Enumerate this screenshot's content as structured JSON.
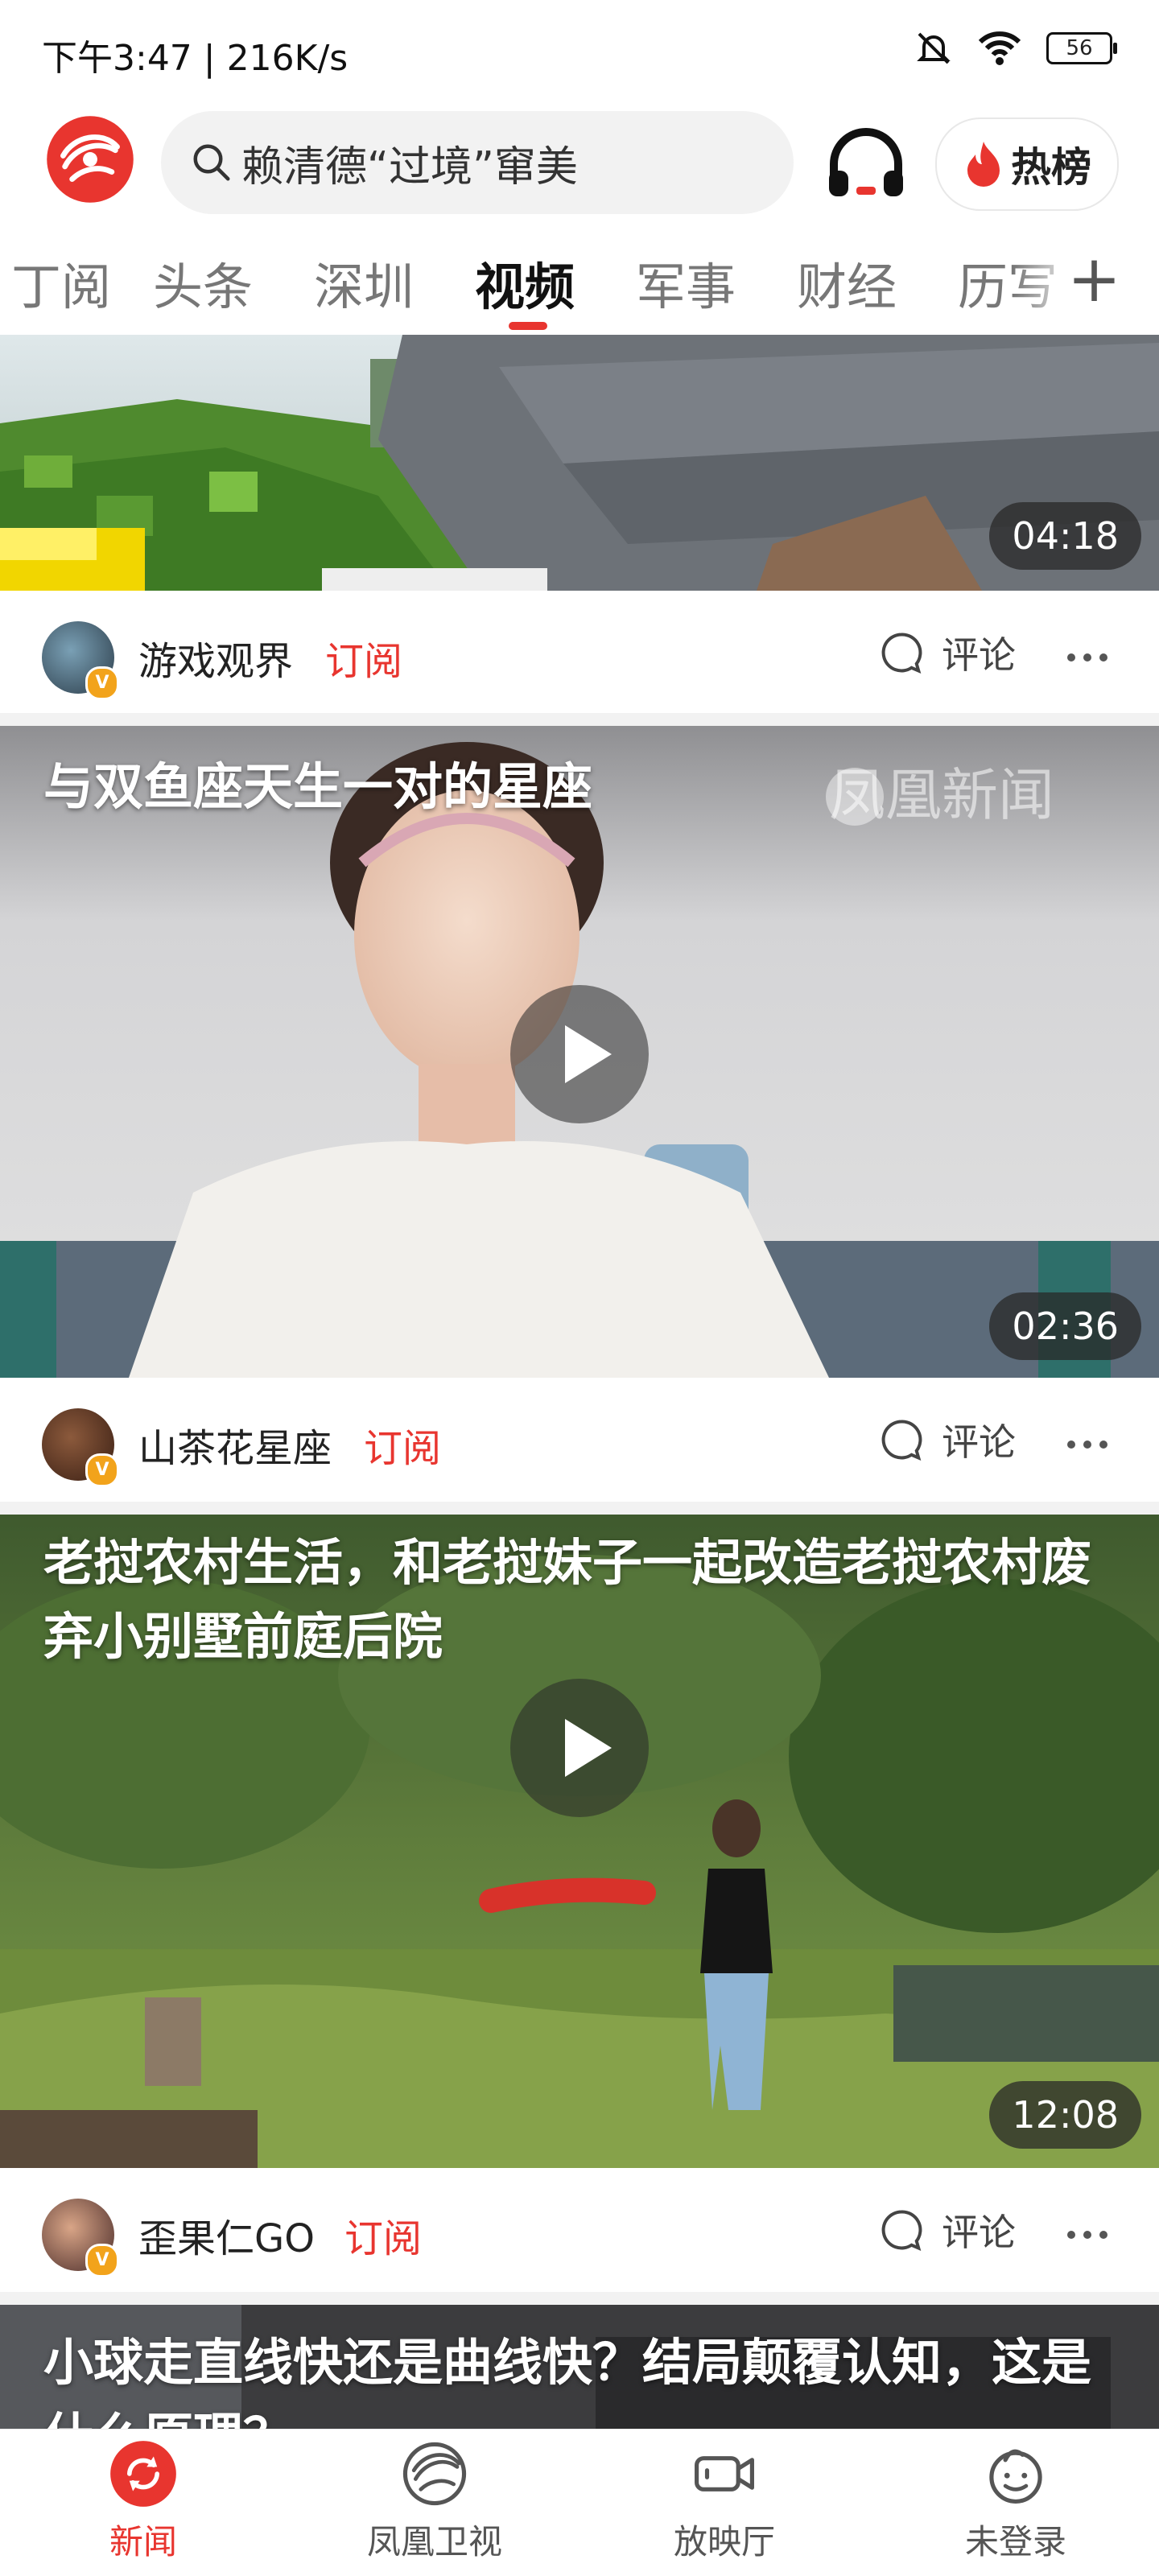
{
  "status_bar": {
    "left_text": "下午3:47 | 216K/s",
    "battery": "56"
  },
  "header": {
    "search_placeholder": "赖清德“过境”窜美",
    "hot_label": "热榜"
  },
  "tabs": [
    {
      "label": "订阅",
      "visible_text": "丁阅"
    },
    {
      "label": "头条"
    },
    {
      "label": "深圳"
    },
    {
      "label": "视频",
      "active": true
    },
    {
      "label": "军事"
    },
    {
      "label": "财经"
    },
    {
      "label": "历史",
      "visible_text": "历写"
    }
  ],
  "videos": [
    {
      "title": "",
      "duration": "04:18",
      "author": "游戏观界",
      "subscribe_label": "订阅",
      "comment_label": "评论"
    },
    {
      "title": "与双鱼座天生一对的星座",
      "watermark": "凤凰新闻",
      "duration": "02:36",
      "author": "山茶花星座",
      "subscribe_label": "订阅",
      "comment_label": "评论"
    },
    {
      "title": "老挝农村生活，和老挝妹子一起改造老挝农村废弃小别墅前庭后院",
      "duration": "12:08",
      "author": "歪果仁GO",
      "subscribe_label": "订阅",
      "comment_label": "评论"
    },
    {
      "title": "小球走直线快还是曲线快？结局颠覆认知，这是什么原理？"
    }
  ],
  "bottom_nav": [
    {
      "label": "新闻",
      "icon": "refresh-icon",
      "active": true
    },
    {
      "label": "凤凰卫视",
      "icon": "phoenix-tv-icon"
    },
    {
      "label": "放映厅",
      "icon": "video-camera-icon"
    },
    {
      "label": "未登录",
      "icon": "user-icon"
    }
  ],
  "colors": {
    "accent": "#e8352f",
    "badge": "#f2a31b"
  }
}
